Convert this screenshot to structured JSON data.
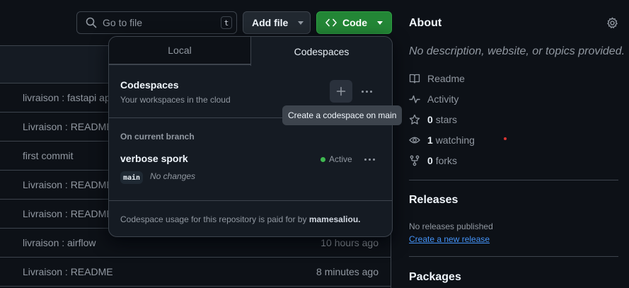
{
  "toolbar": {
    "goto_placeholder": "Go to file",
    "goto_shortcut": "t",
    "add_file_label": "Add file",
    "code_label": "Code",
    "code_icon": "code-brackets-icon"
  },
  "files": {
    "rows": [
      {
        "message": "livraison : fastapi ap",
        "time": ""
      },
      {
        "message": "Livraison : README",
        "time": ""
      },
      {
        "message": "first commit",
        "time": ""
      },
      {
        "message": "Livraison : README",
        "time": ""
      },
      {
        "message": "Livraison : README",
        "time": ""
      },
      {
        "message": "livraison : airflow",
        "time": "10 hours ago"
      },
      {
        "message": "Livraison : README",
        "time": "8 minutes ago"
      }
    ]
  },
  "dropdown": {
    "tabs": [
      "Local",
      "Codespaces"
    ],
    "active_tab": "Codespaces",
    "codespaces_title": "Codespaces",
    "codespaces_subtitle": "Your workspaces in the cloud",
    "branch_heading": "On current branch",
    "codespace": {
      "name": "verbose spork",
      "status": "Active",
      "branch": "main",
      "changes": "No changes"
    },
    "footer_prefix": "Codespace usage for this repository is paid for by ",
    "footer_owner": "mamesaliou."
  },
  "tooltip": "Create a codespace on main",
  "sidebar": {
    "about_title": "About",
    "description": "No description, website, or topics provided.",
    "items": [
      {
        "icon": "book-icon",
        "value": "",
        "label": "Readme"
      },
      {
        "icon": "pulse-icon",
        "value": "",
        "label": "Activity"
      },
      {
        "icon": "star-icon",
        "value": "0",
        "label": "stars"
      },
      {
        "icon": "eye-icon",
        "value": "1",
        "label": "watching"
      },
      {
        "icon": "fork-icon",
        "value": "0",
        "label": "forks"
      }
    ],
    "releases_title": "Releases",
    "no_releases": "No releases published",
    "create_release": "Create a new release",
    "packages_title": "Packages"
  },
  "colors": {
    "background": "#0d1117",
    "code_button": "#238636",
    "link": "#4493f8",
    "active_status": "#3fb950"
  }
}
